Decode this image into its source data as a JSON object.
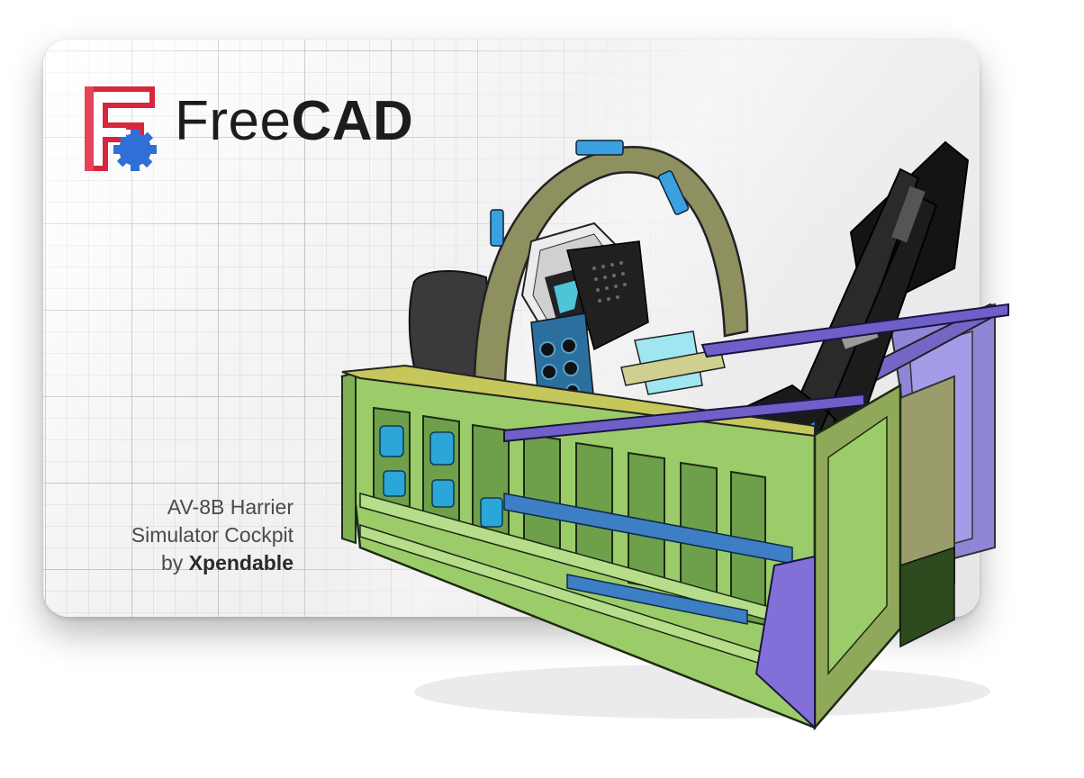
{
  "brand": {
    "name_light": "Free",
    "name_bold": "CAD",
    "logo_icon": "freecad-logo-icon",
    "colors": {
      "logo_red": "#d7263d",
      "logo_blue": "#2f6fd6",
      "wordmark": "#1c1c1e"
    }
  },
  "caption": {
    "line1": "AV-8B Harrier",
    "line2": "Simulator Cockpit",
    "by_prefix": "by ",
    "author": "Xpendable"
  },
  "illustration": {
    "icon": "cockpit-model-illustration",
    "colors": {
      "frame_green": "#9ccc6a",
      "frame_olive": "#8a8f5e",
      "blue_panels": "#3aa0e0",
      "purple_rails": "#6f5fc8",
      "seat_black": "#1a1a1a",
      "seat_brown": "#8b5a3c"
    }
  }
}
